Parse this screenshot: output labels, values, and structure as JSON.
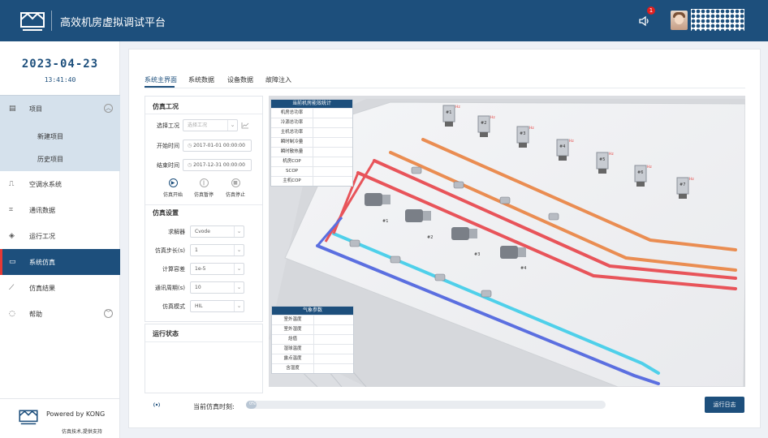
{
  "header": {
    "title": "高效机房虚拟调试平台",
    "notification_count": "1",
    "logo_icon": "kong-logo",
    "bell_icon": "speaker-icon"
  },
  "sidebar": {
    "date": "2023-04-23",
    "time": "13:41:40",
    "items": [
      {
        "label": "项目",
        "icon": "project-icon",
        "expanded": true
      },
      {
        "label": "新建项目"
      },
      {
        "label": "历史项目"
      },
      {
        "label": "空调水系统",
        "icon": "hvac-icon"
      },
      {
        "label": "通讯数据",
        "icon": "comm-icon"
      },
      {
        "label": "运行工况",
        "icon": "layers-icon"
      },
      {
        "label": "系统仿真",
        "icon": "monitor-icon",
        "active": true
      },
      {
        "label": "仿真结果",
        "icon": "chart-icon"
      },
      {
        "label": "帮助",
        "icon": "help-icon"
      }
    ],
    "powered": "Powered by KONG",
    "powered_sub": "仿真技术,提供支持"
  },
  "tabs": [
    "系统主界面",
    "系统数据",
    "设备数据",
    "故障注入"
  ],
  "sim_condition": {
    "title": "仿真工况",
    "select_label": "选择工况",
    "select_placeholder": "选择工况",
    "start_label": "开始时间",
    "start_value": "2017-01-01 00:00:00",
    "end_label": "结束时间",
    "end_value": "2017-12-31 00:00:00",
    "controls": [
      "仿真开始",
      "仿真暂停",
      "仿真停止"
    ]
  },
  "sim_settings": {
    "title": "仿真设置",
    "fields": [
      {
        "label": "求解器",
        "value": "Cvode"
      },
      {
        "label": "仿真步长(s)",
        "value": "1"
      },
      {
        "label": "计算容差",
        "value": "1e-5"
      },
      {
        "label": "通讯周期(s)",
        "value": "10"
      },
      {
        "label": "仿真模式",
        "value": "HIL"
      }
    ]
  },
  "run_status": {
    "title": "运行状态"
  },
  "energy_table": {
    "title": "当前机房能效统计",
    "rows": [
      "机房总功率",
      "冷源总功率",
      "主机总功率",
      "瞬时制冷量",
      "瞬时散热量",
      "机房COP",
      "SCOP",
      "主机COP"
    ]
  },
  "weather_table": {
    "title": "气象参数",
    "rows": [
      "室外温度",
      "室外湿度",
      "焓值",
      "湿球温度",
      "露点温度",
      "含湿度"
    ]
  },
  "diagram": {
    "tower_labels": [
      "#1",
      "#2",
      "#3",
      "#4",
      "#5",
      "#6",
      "#7"
    ],
    "chiller_labels": [
      "#1",
      "#2",
      "#3",
      "#4"
    ],
    "hz_label": "Hz"
  },
  "footer": {
    "sim_time_label": "当前仿真时刻:",
    "progress_text": "0%",
    "progress_value": 0,
    "log_button": "运行日志"
  }
}
